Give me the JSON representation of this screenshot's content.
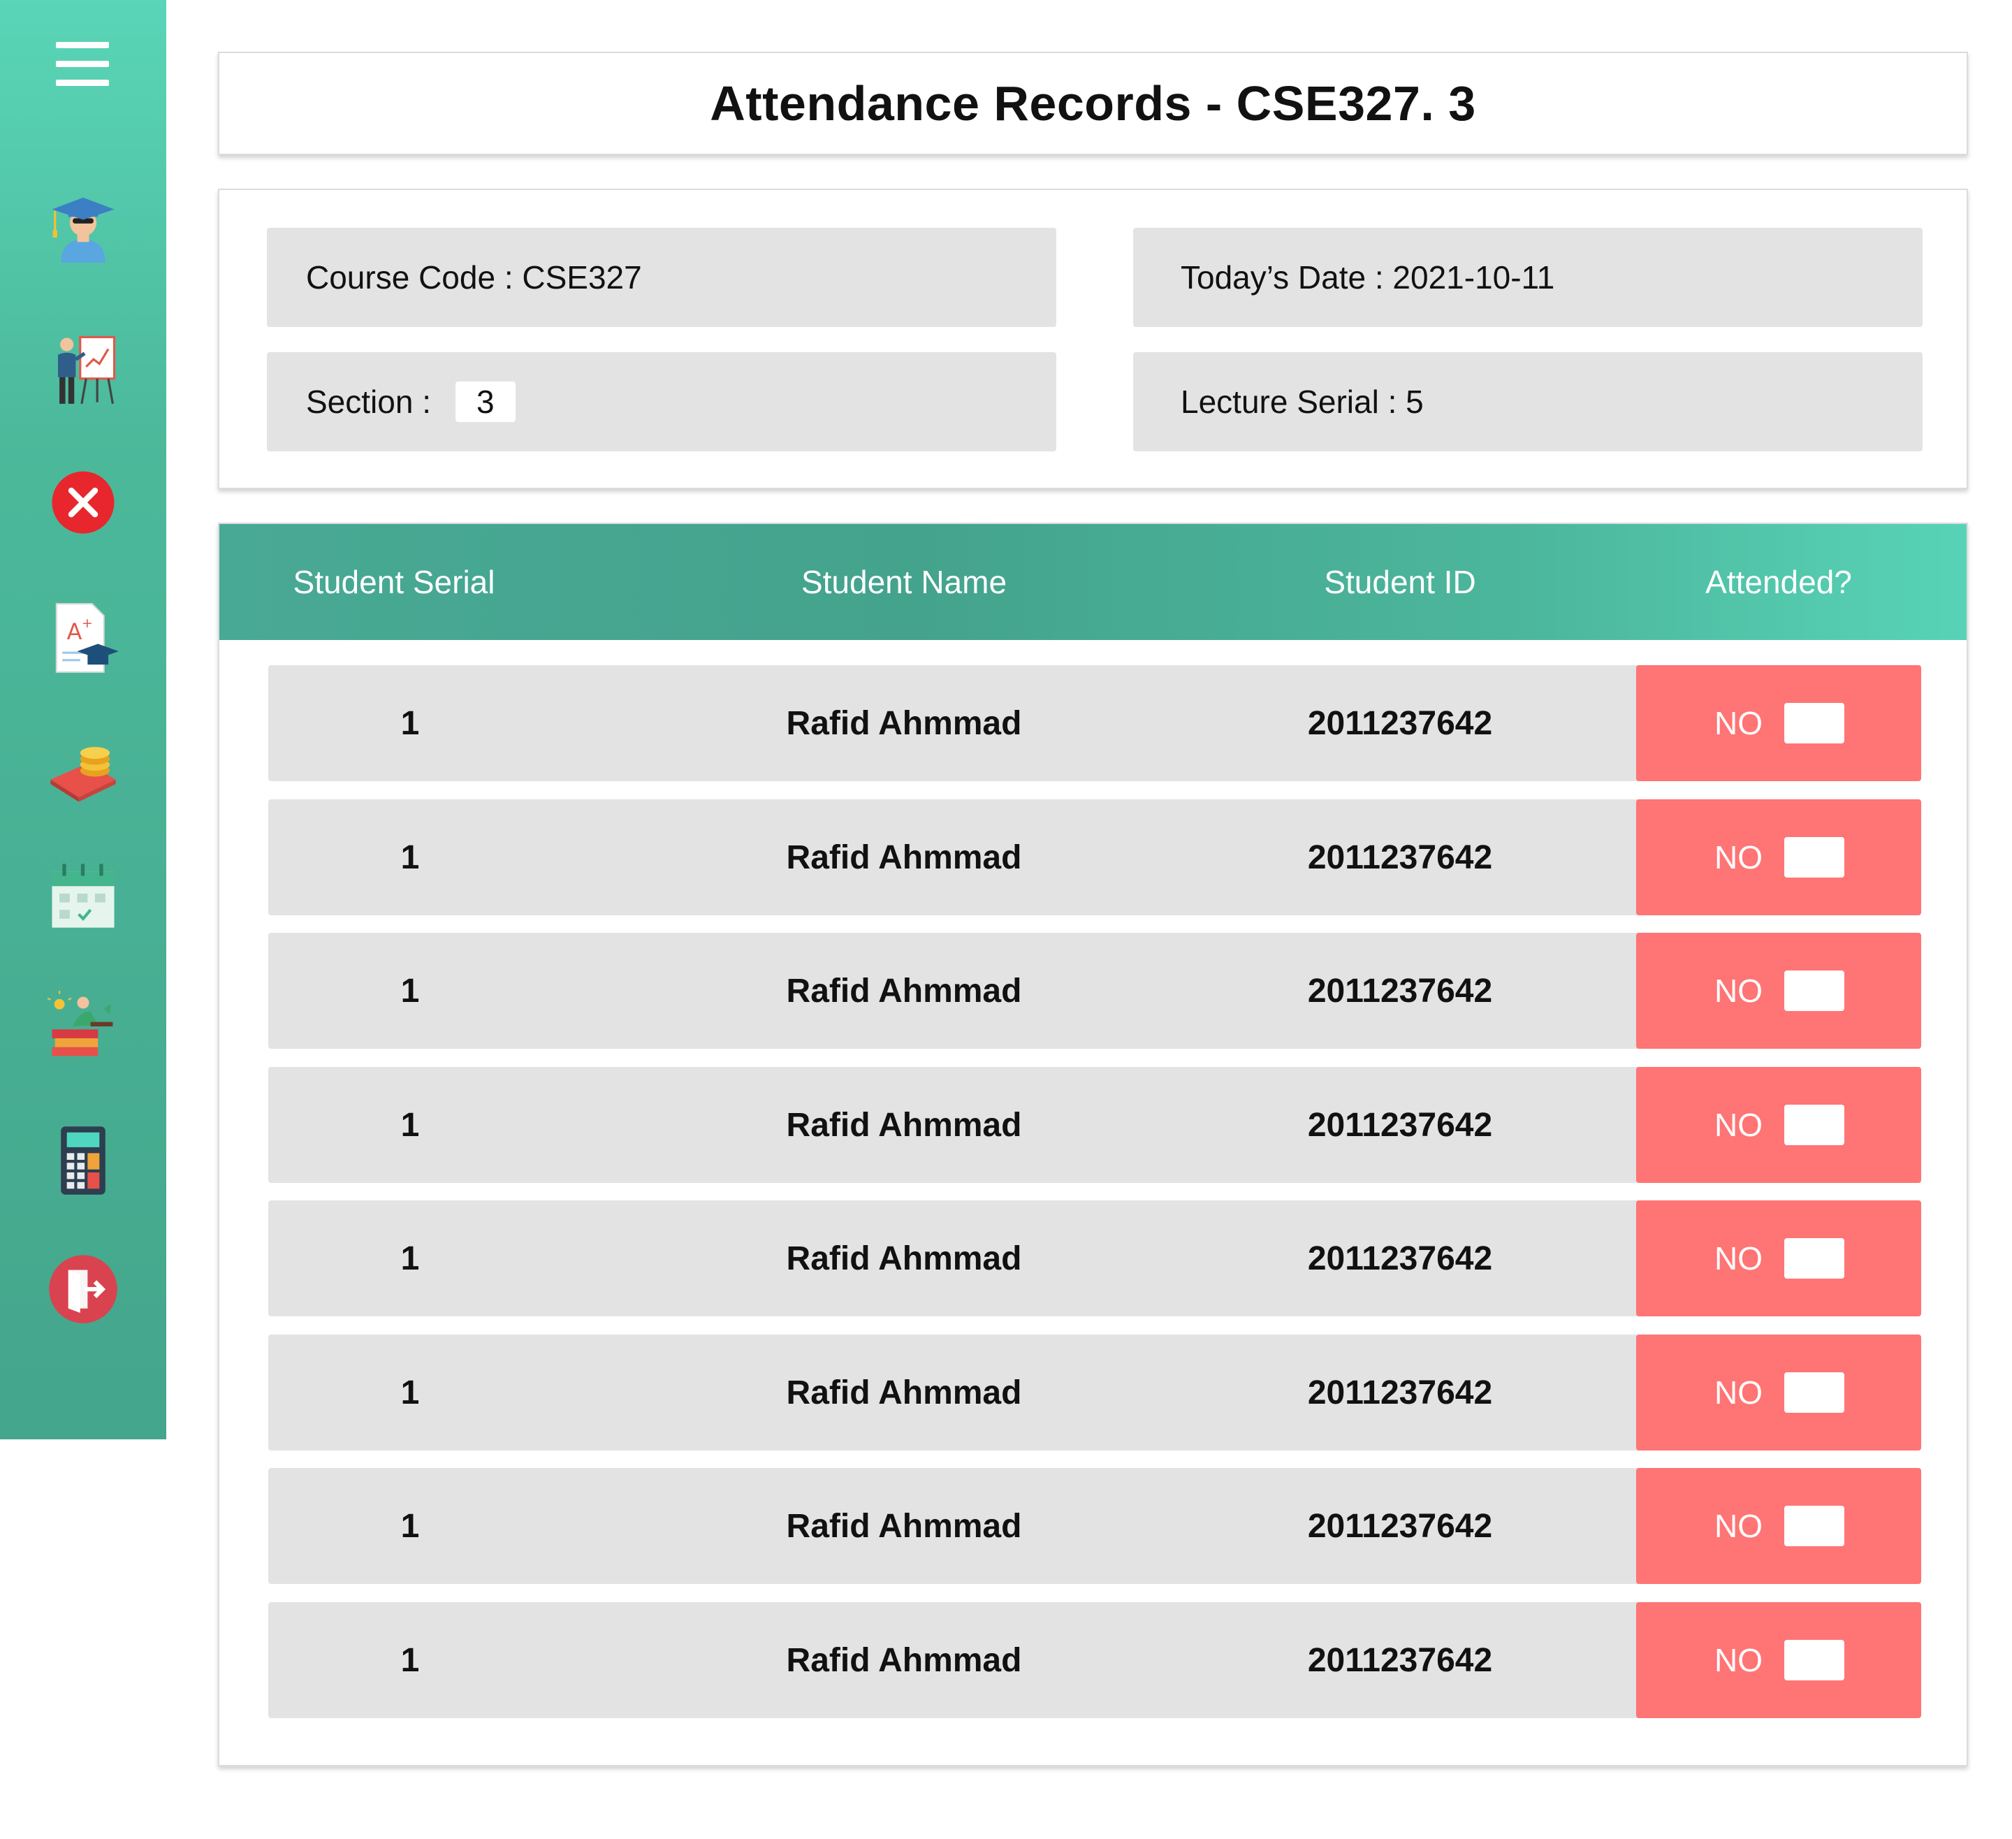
{
  "sidebar": {
    "menu_icon": "hamburger-menu-icon",
    "items": [
      {
        "icon": "graduate-student-icon"
      },
      {
        "icon": "teacher-presentation-icon"
      },
      {
        "icon": "red-close-icon"
      },
      {
        "icon": "grade-document-icon"
      },
      {
        "icon": "payment-coins-icon"
      },
      {
        "icon": "calendar-icon"
      },
      {
        "icon": "study-books-icon"
      },
      {
        "icon": "calculator-icon"
      },
      {
        "icon": "logout-door-icon"
      }
    ]
  },
  "page": {
    "title": "Attendance Records - CSE327. 3"
  },
  "info": {
    "course_code_label": "Course Code : CSE327",
    "date_label": "Today’s Date : 2021-10-11",
    "section_label": "Section : ",
    "section_value": "3",
    "lecture_serial_label": "Lecture Serial : 5"
  },
  "table": {
    "headers": [
      "Student Serial",
      "Student Name",
      "Student ID",
      "Attended?"
    ],
    "rows": [
      {
        "serial": "1",
        "name": "Rafid Ahmmad",
        "id": "2011237642",
        "attended": "NO"
      },
      {
        "serial": "1",
        "name": "Rafid Ahmmad",
        "id": "2011237642",
        "attended": "NO"
      },
      {
        "serial": "1",
        "name": "Rafid Ahmmad",
        "id": "2011237642",
        "attended": "NO"
      },
      {
        "serial": "1",
        "name": "Rafid Ahmmad",
        "id": "2011237642",
        "attended": "NO"
      },
      {
        "serial": "1",
        "name": "Rafid Ahmmad",
        "id": "2011237642",
        "attended": "NO"
      },
      {
        "serial": "1",
        "name": "Rafid Ahmmad",
        "id": "2011237642",
        "attended": "NO"
      },
      {
        "serial": "1",
        "name": "Rafid Ahmmad",
        "id": "2011237642",
        "attended": "NO"
      },
      {
        "serial": "1",
        "name": "Rafid Ahmmad",
        "id": "2011237642",
        "attended": "NO"
      }
    ]
  },
  "colors": {
    "sidebar_top": "#5ad5b7",
    "sidebar_bottom": "#44a68c",
    "header_left": "#48a994",
    "header_right": "#58d3b6",
    "row_background": "#e3e3e3",
    "attended_no": "#ff7474"
  }
}
